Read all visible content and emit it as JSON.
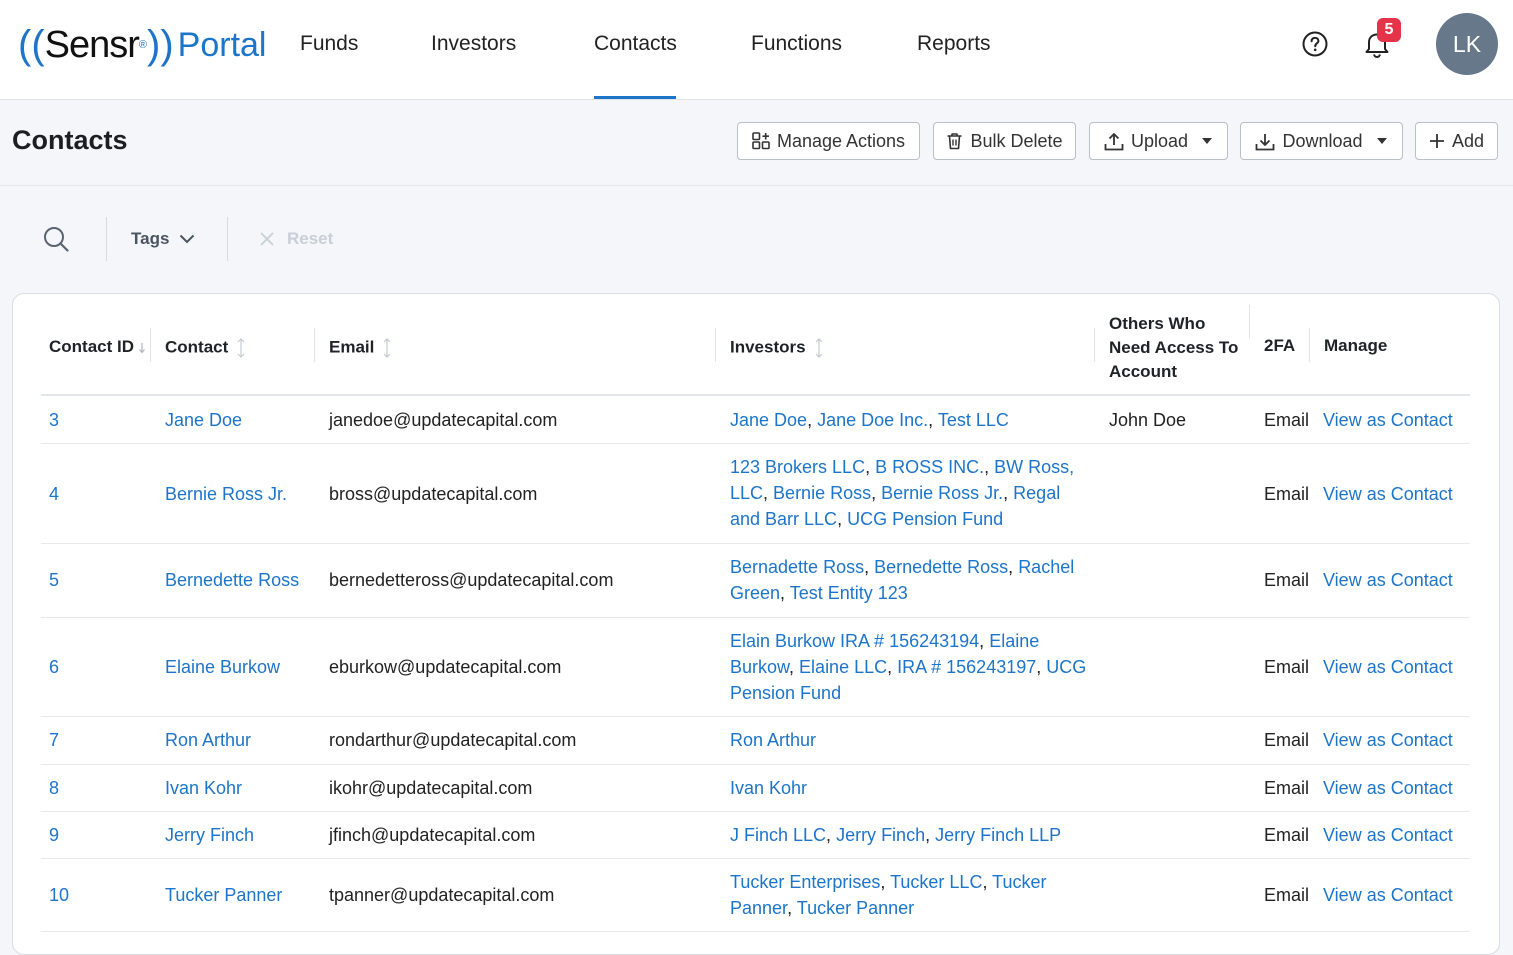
{
  "app": {
    "logo_main": "Sensr",
    "logo_sub": "Portal",
    "nav": [
      "Funds",
      "Investors",
      "Contacts",
      "Functions",
      "Reports"
    ],
    "active_nav": "Contacts",
    "notification_count": "5",
    "avatar_initials": "LK"
  },
  "page": {
    "title": "Contacts",
    "actions": {
      "manage_actions": "Manage Actions",
      "bulk_delete": "Bulk Delete",
      "upload": "Upload",
      "download": "Download",
      "add": "Add"
    }
  },
  "filters": {
    "tags": "Tags",
    "reset": "Reset"
  },
  "table": {
    "headers": {
      "id": "Contact ID",
      "contact": "Contact",
      "email": "Email",
      "investors": "Investors",
      "others_1": "Others Who",
      "others_2": "Need Access To",
      "others_3": "Account",
      "twofa": "2FA",
      "manage": "Manage"
    },
    "rows": [
      {
        "id": "3",
        "contact": "Jane Doe",
        "email": "janedoe@updatecapital.com",
        "investors": [
          "Jane Doe",
          "Jane Doe Inc.",
          "Test LLC"
        ],
        "others": "John Doe",
        "twofa": "Email",
        "manage": "View as Contact"
      },
      {
        "id": "4",
        "contact": "Bernie Ross Jr.",
        "email": "bross@updatecapital.com",
        "investors": [
          "123 Brokers LLC",
          "B ROSS INC.",
          "BW Ross, LLC",
          "Bernie Ross",
          "Bernie Ross Jr.",
          "Regal and Barr LLC",
          "UCG Pension Fund"
        ],
        "others": "",
        "twofa": "Email",
        "manage": "View as Contact"
      },
      {
        "id": "5",
        "contact": "Bernedette Ross",
        "email": "bernedetteross@updatecapital.com",
        "investors": [
          "Bernadette Ross",
          "Bernedette Ross",
          "Rachel Green",
          "Test Entity 123"
        ],
        "others": "",
        "twofa": "Email",
        "manage": "View as Contact"
      },
      {
        "id": "6",
        "contact": "Elaine Burkow",
        "email": "eburkow@updatecapital.com",
        "investors": [
          "Elain Burkow IRA # 156243194",
          "Elaine Burkow",
          "Elaine LLC",
          "IRA # 156243197",
          "UCG Pension Fund"
        ],
        "others": "",
        "twofa": "Email",
        "manage": "View as Contact"
      },
      {
        "id": "7",
        "contact": "Ron Arthur",
        "email": "rondarthur@updatecapital.com",
        "investors": [
          "Ron Arthur"
        ],
        "others": "",
        "twofa": "Email",
        "manage": "View as Contact"
      },
      {
        "id": "8",
        "contact": "Ivan Kohr",
        "email": "ikohr@updatecapital.com",
        "investors": [
          "Ivan Kohr"
        ],
        "others": "",
        "twofa": "Email",
        "manage": "View as Contact"
      },
      {
        "id": "9",
        "contact": "Jerry Finch",
        "email": "jfinch@updatecapital.com",
        "investors": [
          "J Finch LLC",
          "Jerry Finch",
          "Jerry Finch LLP"
        ],
        "others": "",
        "twofa": "Email",
        "manage": "View as Contact"
      },
      {
        "id": "10",
        "contact": "Tucker Panner",
        "email": "tpanner@updatecapital.com",
        "investors": [
          "Tucker Enterprises",
          "Tucker LLC",
          "Tucker Panner",
          "Tucker Panner"
        ],
        "others": "",
        "twofa": "Email",
        "manage": "View as Contact"
      }
    ]
  },
  "colors": {
    "accent": "#1d75c9",
    "badge": "#e5344a",
    "avatar": "#66788a"
  }
}
